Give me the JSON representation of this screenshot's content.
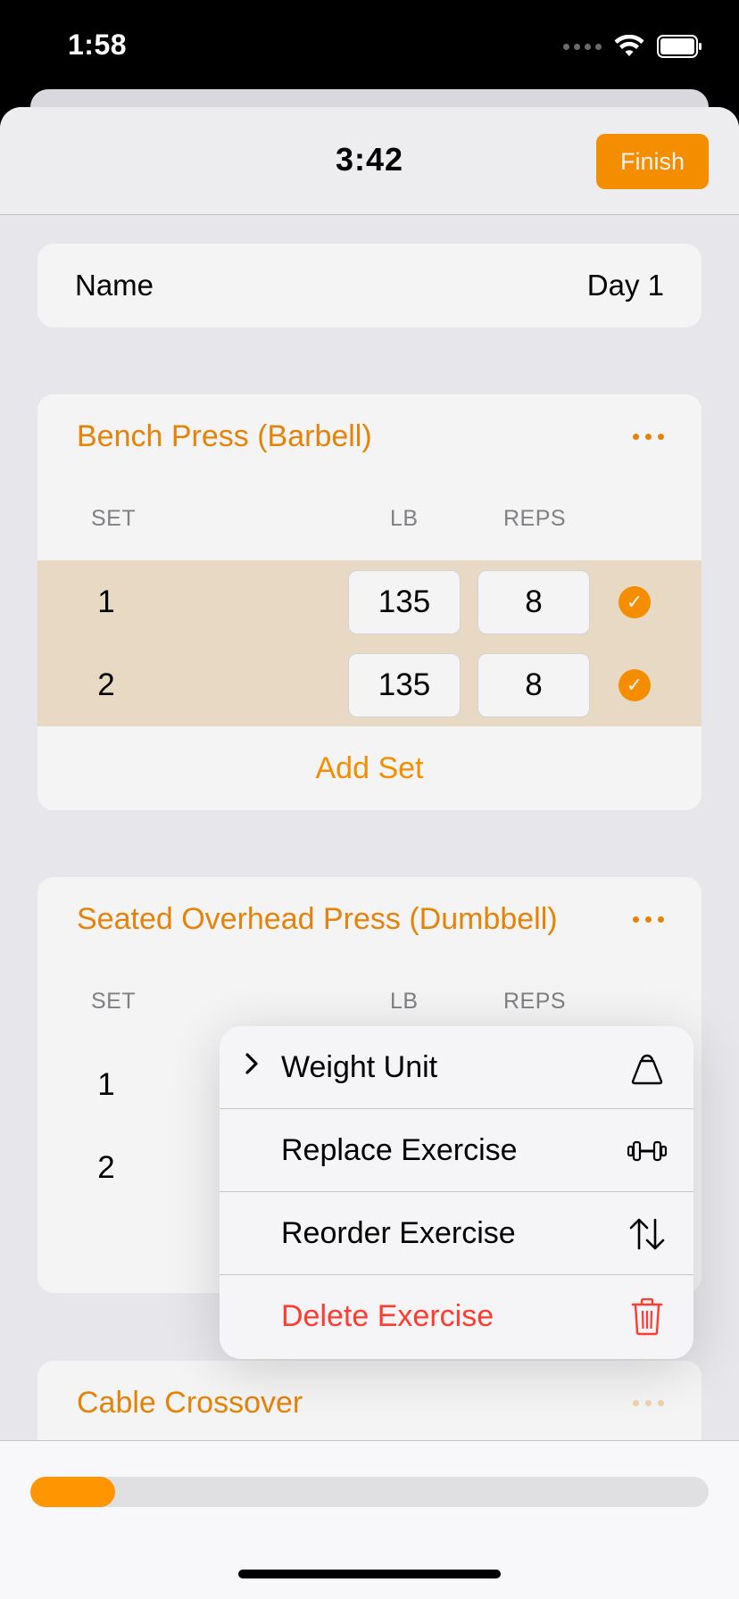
{
  "status": {
    "time": "1:58"
  },
  "nav": {
    "timer": "3:42",
    "finish_label": "Finish"
  },
  "workout": {
    "name_label": "Name",
    "name_value": "Day 1"
  },
  "columns": {
    "set": "SET",
    "lb": "LB",
    "reps": "REPS"
  },
  "exercises": [
    {
      "title": "Bench Press (Barbell)",
      "sets": [
        {
          "num": "1",
          "lb": "135",
          "reps": "8",
          "done": true
        },
        {
          "num": "2",
          "lb": "135",
          "reps": "8",
          "done": true
        }
      ],
      "add_set_label": "Add Set"
    },
    {
      "title": "Seated Overhead Press (Dumbbell)",
      "sets": [
        {
          "num": "1"
        },
        {
          "num": "2"
        }
      ]
    },
    {
      "title": "Cable Crossover"
    }
  ],
  "menu": {
    "items": [
      {
        "label": "Weight Unit",
        "icon": "kettlebell-icon",
        "has_submenu": true
      },
      {
        "label": "Replace Exercise",
        "icon": "dumbbell-icon"
      },
      {
        "label": "Reorder Exercise",
        "icon": "reorder-arrows-icon"
      },
      {
        "label": "Delete Exercise",
        "icon": "trash-icon",
        "destructive": true
      }
    ]
  },
  "progress": {
    "fraction": 0.125
  },
  "colors": {
    "accent": "#ff9500",
    "accent_text": "#f0890a",
    "destructive": "#ff3b30",
    "done_row": "#f3e3cd"
  }
}
